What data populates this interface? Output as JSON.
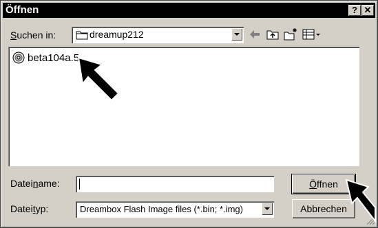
{
  "window": {
    "title": "Öffnen",
    "help_btn": "?",
    "close_btn": "✕"
  },
  "lookin": {
    "label_pre": "",
    "label_u": "S",
    "label_post": "uchen in:",
    "value": "dreamup212"
  },
  "toolbar": {
    "icons": [
      "back-icon",
      "up-folder-icon",
      "new-folder-icon",
      "view-menu-icon"
    ]
  },
  "files": [
    {
      "name": "beta104a.5",
      "icon": "disc-image-icon"
    }
  ],
  "filename": {
    "label_pre": "Datei",
    "label_u": "n",
    "label_post": "ame:",
    "value": ""
  },
  "filetype": {
    "label_pre": "Datei",
    "label_u": "t",
    "label_post": "yp:",
    "value": "Dreambox Flash Image files (*.bin; *.img)"
  },
  "buttons": {
    "open": {
      "pre": "",
      "u": "Ö",
      "post": "ffnen"
    },
    "cancel": {
      "label": "Abbrechen"
    }
  }
}
